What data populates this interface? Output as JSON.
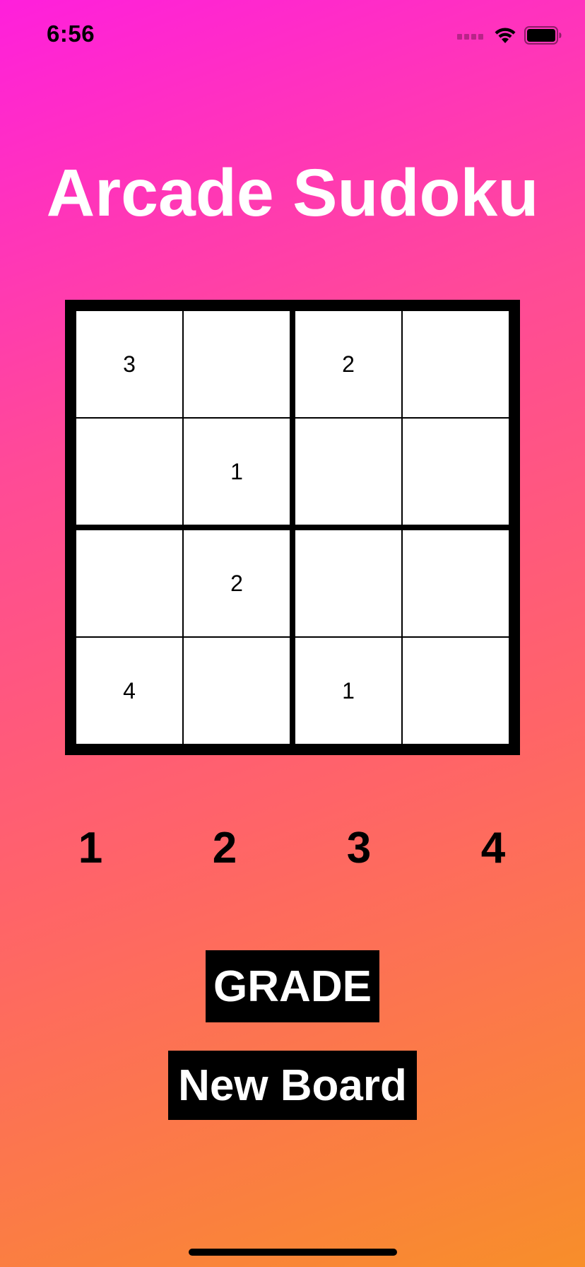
{
  "status_bar": {
    "time": "6:56",
    "icons": [
      "cellular-signal-icon",
      "wifi-icon",
      "battery-icon"
    ]
  },
  "app": {
    "title": "Arcade Sudoku"
  },
  "board": {
    "size": 4,
    "cells": [
      [
        "3",
        "",
        "2",
        ""
      ],
      [
        "",
        "1",
        "",
        ""
      ],
      [
        "",
        "2",
        "",
        ""
      ],
      [
        "4",
        "",
        "1",
        ""
      ]
    ]
  },
  "picker": {
    "numbers": [
      "1",
      "2",
      "3",
      "4"
    ]
  },
  "buttons": {
    "grade_label": "GRADE",
    "new_board_label": "New Board"
  },
  "colors": {
    "gradient_start": "#ff1fdc",
    "gradient_mid": "#ff5a7a",
    "gradient_end": "#f88e2a",
    "title": "#ffffff",
    "button_bg": "#000000",
    "button_text": "#ffffff"
  }
}
